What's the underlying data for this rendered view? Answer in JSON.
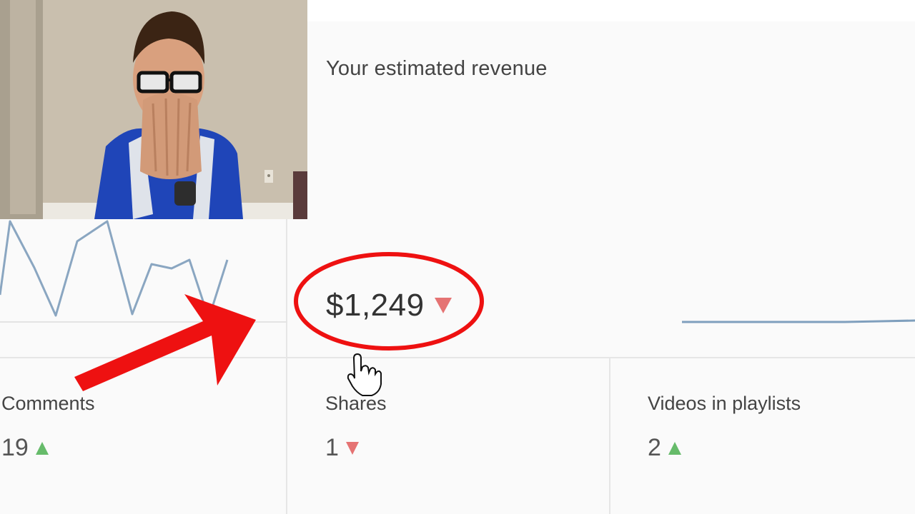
{
  "revenue": {
    "title": "Your estimated revenue",
    "value": "$1,249",
    "trend": "down",
    "trend_color": "#e57373"
  },
  "stats": [
    {
      "label": "Comments",
      "value": "19",
      "trend": "up"
    },
    {
      "label": "Shares",
      "value": "1",
      "trend": "down"
    },
    {
      "label": "Videos in playlists",
      "value": "2",
      "trend": "up"
    }
  ],
  "colors": {
    "up": "#66bb6a",
    "down": "#e57373",
    "annotation_red": "#ee1111",
    "chart_line": "#7f9fbd"
  },
  "overlay": {
    "webcam": "reaction-webcam-thumbnail",
    "arrow_icon": "red-arrow-icon",
    "circle": "red-highlight-circle",
    "cursor_icon": "hand-pointer-icon"
  }
}
